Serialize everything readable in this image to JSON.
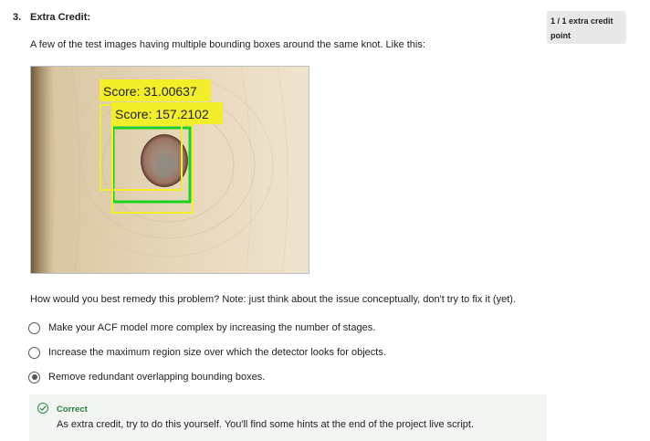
{
  "question": {
    "number": "3.",
    "title": "Extra Credit:",
    "points": "1 / 1 extra credit point",
    "intro": "A few of the test images having multiple bounding boxes around the same knot. Like this:",
    "image": {
      "labels": [
        "Score: 31.00637",
        "Score: 157.2102"
      ],
      "colors": {
        "yellow_box": "#f2ee2a",
        "green_box": "#1fd11f"
      }
    },
    "prompt": "How would you best remedy this problem? Note: just think about the issue conceptually, don't try to fix it (yet).",
    "options": [
      {
        "label": "Make your ACF model more complex by increasing the number of stages.",
        "selected": false
      },
      {
        "label": "Increase the maximum region size over which the detector looks for objects.",
        "selected": false
      },
      {
        "label": "Remove redundant overlapping bounding boxes.",
        "selected": true
      }
    ],
    "feedback": {
      "status": "Correct",
      "text": "As extra credit, try to do this yourself. You'll find some hints at the end of the project live script.",
      "color": "#2a7d40"
    }
  }
}
